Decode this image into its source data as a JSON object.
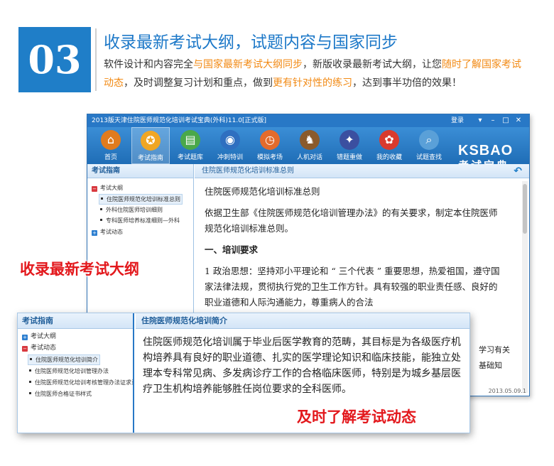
{
  "header": {
    "badge_number": "03",
    "headline": "收录最新考试大纲，试题内容与国家同步",
    "desc_1": "软件设计和内容完全",
    "desc_hl_1": "与国家最新考试大纲同步",
    "desc_2": "，新版收录最新考试大纲，让您",
    "desc_hl_2": "随时了解国家考试动态",
    "desc_3": "，及时调整复习计划和重点，做到",
    "desc_hl_3": "更有针对性的练习",
    "desc_4": "，达到事半功倍的效果！"
  },
  "window": {
    "title": "2013版天津住院医师规范化培训考试宝典(外科)11.0[正式版]",
    "login": "登录",
    "controls": [
      "▾",
      "–",
      "□",
      "✕"
    ],
    "toolbar": [
      {
        "label": "首页",
        "icon": "house-icon",
        "glyph": "⌂",
        "color": "#e07b1e"
      },
      {
        "label": "考试指南",
        "icon": "compass-icon",
        "glyph": "✪",
        "color": "#f0a623"
      },
      {
        "label": "考试题库",
        "icon": "books-icon",
        "glyph": "▤",
        "color": "#4aa84a"
      },
      {
        "label": "冲刺特训",
        "icon": "globe-icon",
        "glyph": "◉",
        "color": "#2e6fc0"
      },
      {
        "label": "模拟考场",
        "icon": "clock-icon",
        "glyph": "◷",
        "color": "#e36b2c"
      },
      {
        "label": "人机对话",
        "icon": "chess-icon",
        "glyph": "♞",
        "color": "#8a5a2c"
      },
      {
        "label": "错题重做",
        "icon": "compass-rose-icon",
        "glyph": "✦",
        "color": "#3b4fa0"
      },
      {
        "label": "我的收藏",
        "icon": "gift-icon",
        "glyph": "✿",
        "color": "#d93a2e"
      },
      {
        "label": "试题查找",
        "icon": "magnifier-icon",
        "glyph": "⌕",
        "color": "#5aa0d8"
      }
    ],
    "brand_en": "KSBAO",
    "brand_cn": "考试宝典",
    "left_pane": {
      "title": "考试指南",
      "items": [
        {
          "label": "考试大纲",
          "type": "minus"
        },
        {
          "label": "住院医师规范化培训标准总则",
          "type": "child",
          "selected": true
        },
        {
          "label": "外科住院医师培训细则",
          "type": "child"
        },
        {
          "label": "专科医师培养标准细则—外科",
          "type": "child"
        },
        {
          "label": "考试动态",
          "type": "plus"
        }
      ]
    },
    "right_pane": {
      "title": "住院医师规范化培训标准总则",
      "p1": "住院医师规范化培训标准总则",
      "p2": "依据卫生部《住院医师规范化培训管理办法》的有关要求，制定本住院医师规范化培训标准总则。",
      "h1": "一、培训要求",
      "p3": "1 政治思想：坚持邓小平理论和 “ 三个代表 ” 重要思想，热爱祖国，遵守国家法律法规，贯彻执行党的卫生工作方针。具有较强的职业责任感、良好的职业道德和人际沟通能力，尊重病人的合法",
      "behind_1": "学习有关",
      "behind_2": "基础知",
      "status": "2013.05.09.1"
    }
  },
  "captions": {
    "caption_1": "收录最新考试大纲",
    "caption_2": "及时了解考试动态"
  },
  "overlay": {
    "left_title": "考试指南",
    "items": [
      {
        "label": "考试大纲",
        "type": "plus"
      },
      {
        "label": "考试动态",
        "type": "minus"
      },
      {
        "label": "住院医师规范化培训简介",
        "type": "child",
        "selected": true
      },
      {
        "label": "住院医师规范化培训管理办法",
        "type": "child"
      },
      {
        "label": "住院医师规范化培训考核管理办法证求意见",
        "type": "child"
      },
      {
        "label": "住院医师合格证书样式",
        "type": "child"
      }
    ],
    "right_title": "住院医师规范化培训简介",
    "text": "住院医师规范化培训属于毕业后医学教育的范畴，其目标是为各级医疗机构培养具有良好的职业道德、扎实的医学理论知识和临床技能，能独立处理本专科常见病、多发病诊疗工作的合格临床医师，特别是为城乡基层医疗卫生机构培养能够胜任岗位要求的全科医师。"
  }
}
